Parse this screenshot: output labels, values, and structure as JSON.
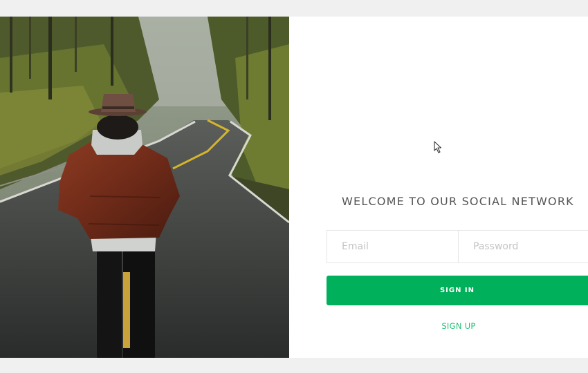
{
  "hero": {
    "image": "person-in-brown-leather-jacket-and-hat-walking-on-winding-forest-road"
  },
  "login": {
    "heading": "WELCOME TO OUR SOCIAL NETWORK",
    "email_placeholder": "Email",
    "password_placeholder": "Password",
    "signin_label": "SIGN IN",
    "signup_label": "SIGN UP"
  },
  "colors": {
    "accent": "#00b05a",
    "link": "#1fbf72",
    "background": "#f0f0f0",
    "panel": "#ffffff"
  }
}
